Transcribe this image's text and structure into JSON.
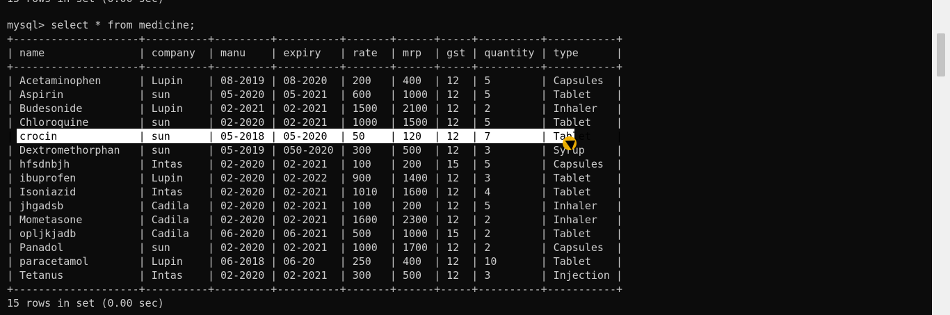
{
  "terminal": {
    "cropped_prev_line": "15 rows in set (0.00 sec)",
    "prompt": "mysql> select * from medicine;",
    "border": "+--------------------+----------+---------+----------+-------+------+-----+----------+-----------+",
    "headers": [
      "name",
      "company",
      "manu",
      "expiry",
      "rate",
      "mrp",
      "gst",
      "quantity",
      "type"
    ],
    "rows": [
      [
        "Acetaminophen",
        "Lupin",
        "08-2019",
        "08-2020",
        "200",
        "400",
        "12",
        "5",
        "Capsules"
      ],
      [
        "Aspirin",
        "sun",
        "05-2020",
        "05-2021",
        "600",
        "1000",
        "12",
        "5",
        "Tablet"
      ],
      [
        "Budesonide",
        "Lupin",
        "02-2021",
        "02-2021",
        "1500",
        "2100",
        "12",
        "2",
        "Inhaler"
      ],
      [
        "Chloroquine",
        "sun",
        "02-2020",
        "02-2021",
        "1000",
        "1500",
        "12",
        "5",
        "Tablet"
      ],
      [
        "crocin",
        "sun",
        "05-2018",
        "05-2020",
        "50",
        "120",
        "12",
        "7",
        "Tablet"
      ],
      [
        "Dextromethorphan",
        "sun",
        "05-2019",
        "050-2020",
        "300",
        "500",
        "12",
        "3",
        "Syrup"
      ],
      [
        "hfsdnbjh",
        "Intas",
        "02-2020",
        "02-2021",
        "100",
        "200",
        "15",
        "5",
        "Capsules"
      ],
      [
        "ibuprofen",
        "Lupin",
        "02-2020",
        "02-2022",
        "900",
        "1400",
        "12",
        "3",
        "Tablet"
      ],
      [
        "Isoniazid",
        "Intas",
        "02-2020",
        "02-2021",
        "1010",
        "1600",
        "12",
        "4",
        "Tablet"
      ],
      [
        "jhgadsb",
        "Cadila",
        "02-2020",
        "02-2021",
        "100",
        "200",
        "12",
        "5",
        "Inhaler"
      ],
      [
        "Mometasone",
        "Cadila",
        "02-2020",
        "02-2021",
        "1600",
        "2300",
        "12",
        "2",
        "Inhaler"
      ],
      [
        "opljkjadb",
        "Cadila",
        "06-2020",
        "06-2021",
        "500",
        "1000",
        "15",
        "2",
        "Tablet"
      ],
      [
        "Panadol",
        "sun",
        "02-2020",
        "02-2021",
        "1000",
        "1700",
        "12",
        "2",
        "Capsules"
      ],
      [
        "paracetamol",
        "Lupin",
        "06-2018",
        "06-20",
        "250",
        "400",
        "12",
        "10",
        "Tablet"
      ],
      [
        "Tetanus",
        "Intas",
        "02-2020",
        "02-2021",
        "300",
        "500",
        "12",
        "3",
        "Injection"
      ]
    ],
    "highlighted_row": 4,
    "result_footer": "15 rows in set (0.00 sec)"
  }
}
